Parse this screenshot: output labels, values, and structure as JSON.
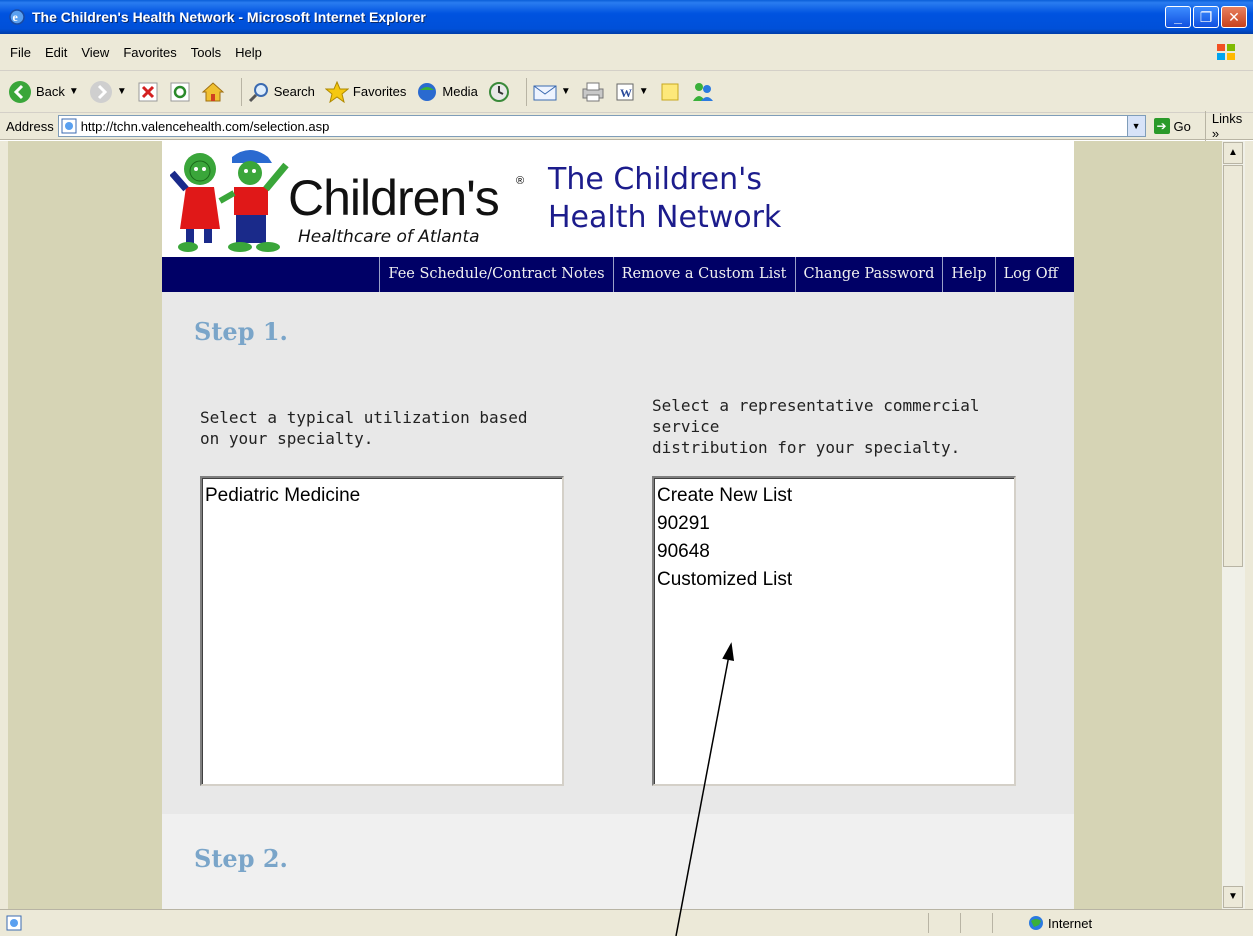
{
  "window": {
    "title": "The Children's Health Network - Microsoft Internet Explorer",
    "controls": {
      "minimize": "_",
      "maximize": "❐",
      "close": "✕"
    }
  },
  "menu": [
    "File",
    "Edit",
    "View",
    "Favorites",
    "Tools",
    "Help"
  ],
  "toolbar": {
    "back": "Back",
    "search": "Search",
    "favorites": "Favorites",
    "media": "Media"
  },
  "address": {
    "label": "Address",
    "url": "http://tchn.valencehealth.com/selection.asp",
    "go": "Go",
    "links": "Links"
  },
  "logo": {
    "brand": "Children's",
    "registered": "®",
    "tagline": "Healthcare of Atlanta"
  },
  "site_title": {
    "line1": "The Children's",
    "line2": "Health Network"
  },
  "nav": [
    "Fee Schedule/Contract Notes",
    "Remove a Custom List",
    "Change Password",
    "Help",
    "Log Off"
  ],
  "step1": {
    "title": "Step 1.",
    "left_instruction_line1": "Select a typical utilization based",
    "left_instruction_line2": "on your specialty.",
    "left_options": [
      "Pediatric Medicine"
    ],
    "right_instruction_line1": "Select a representative commercial",
    "right_instruction_line2": "service",
    "right_instruction_line3": "distribution for your specialty.",
    "right_options": [
      "Create New List",
      "90291",
      "90648",
      "Customized List"
    ]
  },
  "step2": {
    "title": "Step 2."
  },
  "status": {
    "zone": "Internet"
  },
  "colors": {
    "title_bar": "#0054e3",
    "nav_bar": "#000066",
    "step_heading": "#7aa5c9",
    "site_title": "#1c1c8c",
    "side_background": "#d6d4b5"
  }
}
